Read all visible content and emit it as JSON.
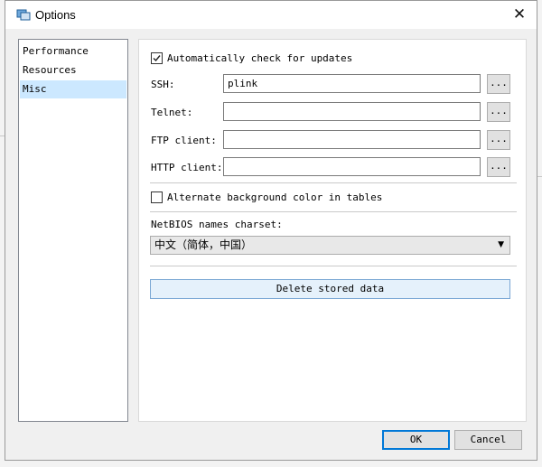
{
  "window": {
    "title": "Options"
  },
  "nav": {
    "items": [
      {
        "label": "Performance"
      },
      {
        "label": "Resources"
      },
      {
        "label": "Misc"
      }
    ]
  },
  "misc": {
    "auto_update_label": "Automatically check for updates",
    "auto_update_checked": true,
    "ssh_label": "SSH:",
    "ssh_value": "plink",
    "telnet_label": "Telnet:",
    "telnet_value": "",
    "ftp_label": "FTP client:",
    "ftp_value": "",
    "http_label": "HTTP client:",
    "http_value": "",
    "browse_label": "...",
    "alt_bg_label": "Alternate background color in tables",
    "alt_bg_checked": false,
    "netbios_label": "NetBIOS names charset:",
    "netbios_value": "中文（简体，中国）",
    "delete_label": "Delete stored data"
  },
  "footer": {
    "ok_label": "OK",
    "cancel_label": "Cancel"
  }
}
